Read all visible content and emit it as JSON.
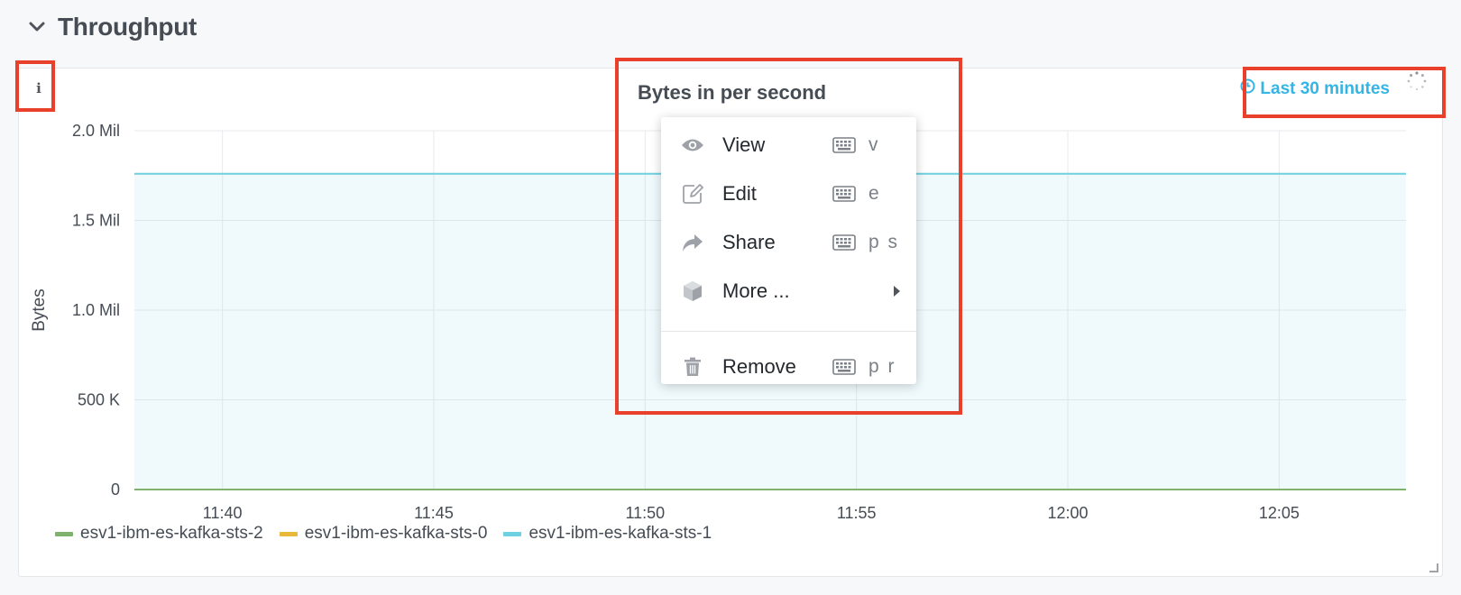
{
  "row": {
    "title": "Throughput"
  },
  "panel": {
    "title": "Bytes in per second",
    "info_label": "i",
    "time_info": "Last 30 minutes"
  },
  "colors": {
    "accent": "#33b5e5",
    "highlight": "#e8402a",
    "series_sts2": "#7eb26d",
    "series_sts0": "#eab839",
    "series_sts1": "#6ed0e0"
  },
  "menu": {
    "items": [
      {
        "label": "View",
        "icon": "eye-icon",
        "shortcut": "v"
      },
      {
        "label": "Edit",
        "icon": "edit-icon",
        "shortcut": "e"
      },
      {
        "label": "Share",
        "icon": "share-icon",
        "shortcut": "p s"
      },
      {
        "label": "More ...",
        "icon": "cube-icon",
        "submenu": true
      }
    ],
    "remove": {
      "label": "Remove",
      "icon": "trash-icon",
      "shortcut": "p r"
    }
  },
  "chart_data": {
    "type": "area",
    "title": "Bytes in per second",
    "ylabel": "Bytes",
    "xlabel": "",
    "ylim": [
      0,
      2000000
    ],
    "yticks": [
      {
        "value": 0,
        "label": "0"
      },
      {
        "value": 500000,
        "label": "500 K"
      },
      {
        "value": 1000000,
        "label": "1.0 Mil"
      },
      {
        "value": 1500000,
        "label": "1.5 Mil"
      },
      {
        "value": 2000000,
        "label": "2.0 Mil"
      }
    ],
    "xlim": [
      "11:37:55",
      "12:08:00"
    ],
    "xticks": [
      "11:40",
      "11:45",
      "11:50",
      "11:55",
      "12:00",
      "12:05"
    ],
    "grid": true,
    "legend_position": "bottom-left",
    "series": [
      {
        "name": "esv1-ibm-es-kafka-sts-2",
        "color": "#7eb26d",
        "x": [
          "11:37:55",
          "12:08:00"
        ],
        "y": [
          0,
          0
        ]
      },
      {
        "name": "esv1-ibm-es-kafka-sts-0",
        "color": "#eab839",
        "x": [
          "11:37:55",
          "12:08:00"
        ],
        "y": [
          0,
          0
        ]
      },
      {
        "name": "esv1-ibm-es-kafka-sts-1",
        "color": "#6ed0e0",
        "x": [
          "11:37:55",
          "12:08:00"
        ],
        "y": [
          1760000,
          1760000
        ]
      }
    ]
  }
}
